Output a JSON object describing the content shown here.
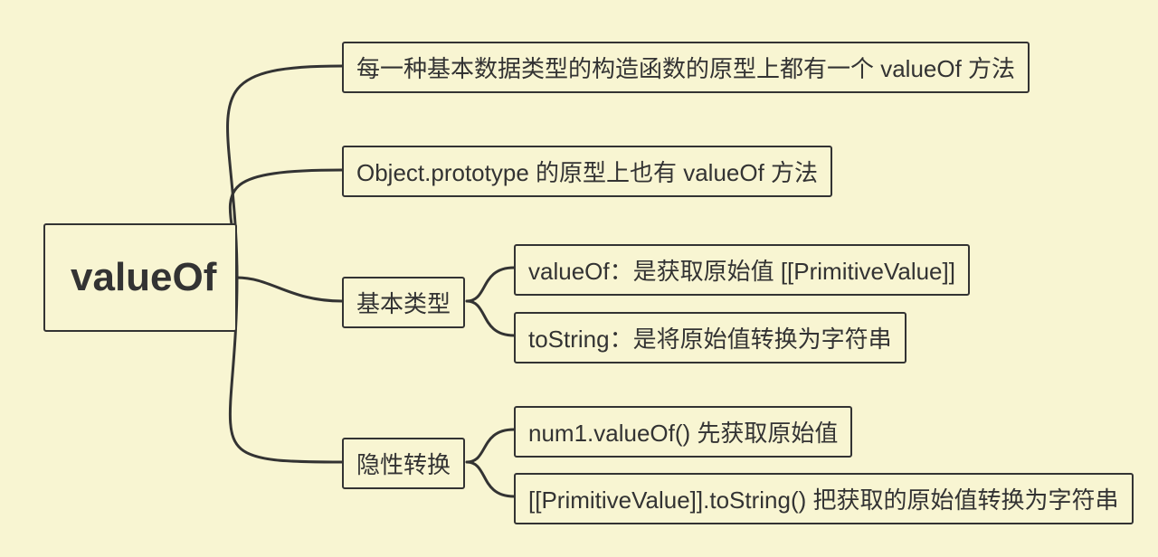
{
  "root": {
    "label": "valueOf"
  },
  "child1": {
    "label": "每一种基本数据类型的构造函数的原型上都有一个 valueOf 方法"
  },
  "child2": {
    "label": "Object.prototype 的原型上也有 valueOf 方法"
  },
  "child3": {
    "label": "基本类型",
    "leaf1": {
      "label": "valueOf：是获取原始值 [[PrimitiveValue]]"
    },
    "leaf2": {
      "label": "toString：是将原始值转换为字符串"
    }
  },
  "child4": {
    "label": "隐性转换",
    "leaf1": {
      "label": "num1.valueOf() 先获取原始值"
    },
    "leaf2": {
      "label": "[[PrimitiveValue]].toString() 把获取的原始值转换为字符串"
    }
  }
}
